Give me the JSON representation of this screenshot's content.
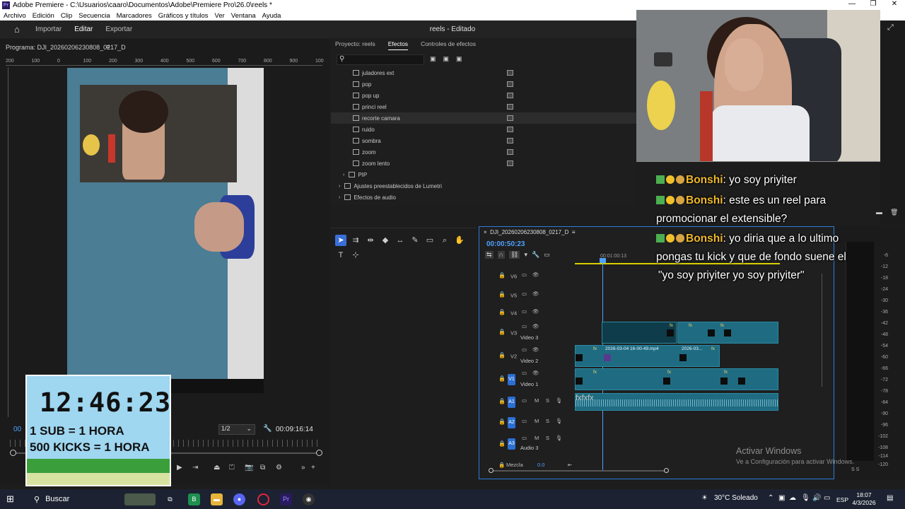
{
  "window": {
    "title": "Adobe Premiere - C:\\Usuarios\\caaro\\Documentos\\Adobe\\Premiere Pro\\26.0\\reels *",
    "logo": "Pr"
  },
  "menu": [
    "Archivo",
    "Edición",
    "Clip",
    "Secuencia",
    "Marcadores",
    "Gráficos y títulos",
    "Ver",
    "Ventana",
    "Ayuda"
  ],
  "header": {
    "nav": [
      "Importar",
      "Editar",
      "Exportar"
    ],
    "active": "Editar",
    "project_title": "reels - Editado"
  },
  "program_monitor": {
    "title": "Programa: DJI_20260206230808_0217_D",
    "ruler_labels": [
      "200",
      "100",
      "0",
      "100",
      "200",
      "300",
      "400",
      "500",
      "600",
      "700",
      "800",
      "900",
      "100"
    ],
    "timecode_left": "00",
    "zoom": "1/2",
    "timecode_right": "00:09:16:14"
  },
  "timer_overlay": {
    "clock": "12:46:23",
    "line1": "1 SUB = 1 HORA",
    "line2": "500 KICKS = 1 HORA"
  },
  "effects_panel": {
    "tabs": [
      "Proyecto: reels",
      "Efectos",
      "Controles de efectos"
    ],
    "active_tab": "Efectos",
    "items": [
      {
        "label": "juladores ext",
        "type": "preset"
      },
      {
        "label": "pop",
        "type": "preset"
      },
      {
        "label": "pop up",
        "type": "preset"
      },
      {
        "label": "princi reel",
        "type": "preset"
      },
      {
        "label": "recorte camara",
        "type": "preset",
        "selected": true
      },
      {
        "label": "ruido",
        "type": "preset"
      },
      {
        "label": "sombra",
        "type": "preset"
      },
      {
        "label": "zoom",
        "type": "preset"
      },
      {
        "label": "zoom lento",
        "type": "preset"
      },
      {
        "label": "PIP",
        "type": "folder"
      },
      {
        "label": "Ajustes preestablecidos de Lumetri",
        "type": "folder-root"
      },
      {
        "label": "Efectos de audio",
        "type": "folder-root"
      }
    ]
  },
  "timeline": {
    "sequence": "DJI_20260206230808_0217_D",
    "timecode": "00:00:50:23",
    "ruler_label": "00:01:00:13",
    "tracks": [
      {
        "id": "V6",
        "label": ""
      },
      {
        "id": "V5",
        "label": ""
      },
      {
        "id": "V4",
        "label": ""
      },
      {
        "id": "V3",
        "label": "Video 3"
      },
      {
        "id": "V2",
        "label": "Video 2"
      },
      {
        "id": "V1",
        "label": "Video 1"
      },
      {
        "id": "A1",
        "label": ""
      },
      {
        "id": "A2",
        "label": ""
      },
      {
        "id": "A3",
        "label": "Audio 3"
      }
    ],
    "clips": {
      "v2_a": "2026-03-04 16-00-49.mp4",
      "v2_b": "2026-03..."
    },
    "mix_label": "Mezcla",
    "mix_value": "0.0",
    "fx_badge": "fx",
    "track_ms": "M",
    "track_s": "S"
  },
  "meter": {
    "labels": [
      "-6",
      "-12",
      "-18",
      "-24",
      "-30",
      "-36",
      "-42",
      "-48",
      "-54",
      "-60",
      "-66",
      "-72",
      "-78",
      "-84",
      "-90",
      "-96",
      "-102",
      "-108",
      "-114",
      "-120"
    ],
    "ss": "S   S"
  },
  "chat": [
    {
      "user": "Bonshi",
      "text": ": yo soy priyiter"
    },
    {
      "user": "Bonshi",
      "text": ": este es un reel para"
    },
    {
      "user": "",
      "text": "promocionar el extensible?"
    },
    {
      "user": "Bonshi",
      "text": ": yo diria que a lo ultimo"
    },
    {
      "user": "",
      "text": "pongas tu kick y que de fondo suene el"
    },
    {
      "user": "",
      "text": "\"yo soy priyiter yo soy priyiter\""
    }
  ],
  "watermark": {
    "line1": "Activar Windows",
    "line2": "Ve a Configuración para activar Windows."
  },
  "taskbar": {
    "search": "Buscar",
    "weather": "30°C  Soleado",
    "lang": "ESP",
    "time": "18:07",
    "date": "4/3/2026"
  }
}
